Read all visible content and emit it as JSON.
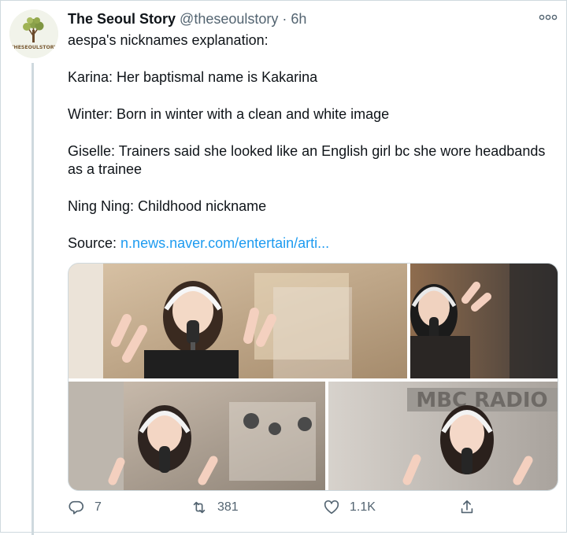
{
  "account": {
    "name": "The Seoul Story",
    "handle": "@theseoulstory",
    "separator": "·",
    "time": "6h",
    "avatar_text": "THESEOULSTORY"
  },
  "menu": {
    "more_label": "ooo"
  },
  "tweet": {
    "lines": [
      "aespa's nicknames explanation:",
      "Karina: Her baptismal name is Kakarina",
      "Winter: Born in winter with a clean and white image",
      "Giselle: Trainers said she looked like an English girl bc she wore headbands as a trainee",
      "Ning Ning: Childhood nickname"
    ],
    "source_label": "Source: ",
    "source_link": "n.news.naver.com/entertain/arti..."
  },
  "media": {
    "watermark": "MBC RADIO"
  },
  "stats": {
    "replies": "7",
    "retweets": "381",
    "likes": "1.1K"
  },
  "icons": {
    "reply": "reply-icon",
    "retweet": "retweet-icon",
    "like": "like-icon",
    "share": "share-icon"
  },
  "colors": {
    "link": "#1d9bf0",
    "muted": "#536471",
    "text": "#0f1419"
  }
}
